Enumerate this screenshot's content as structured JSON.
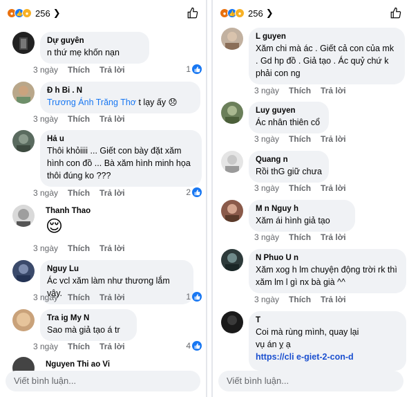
{
  "left": {
    "reaction_count": "256",
    "comments": [
      {
        "name": "Dự   guyên",
        "text": "  n thứ mẹ khốn nạn",
        "time": "3 ngày",
        "like": "Thích",
        "reply": "Trả lời",
        "likes": "1"
      },
      {
        "name": "Đ   h Bi  .   N",
        "mention": "Trương Ánh Trăng Thơ",
        "text": " t lạy ấy 😞",
        "time": "3 ngày",
        "like": "Thích",
        "reply": "Trả lời",
        "likes": ""
      },
      {
        "name": "Hả  u",
        "text": "Thôi khỏiiii ... Giết con bày đặt xăm hình con đồ ... Bà xăm hình minh họa thôi đúng ko ???",
        "time": "3 ngày",
        "like": "Thích",
        "reply": "Trả lời",
        "likes": "2"
      },
      {
        "name": "Thanh Thao",
        "text": "😌",
        "time": "3 ngày",
        "like": "Thích",
        "reply": "Trả lời",
        "likes": ""
      },
      {
        "name": "Nguy   Lu  ",
        "text": "Ác vcl xăm làm như thương lắm vậy.",
        "time": "3 ngày",
        "like": "Thích",
        "reply": "Trả lời",
        "likes": "1"
      },
      {
        "name": "Tra   ig   My N",
        "text": "Sao mà giả tạo á tr",
        "time": "3 ngày",
        "like": "Thích",
        "reply": "Trả lời",
        "likes": "4"
      },
      {
        "name": "Nguyen Thi   ao Vi",
        "text": "",
        "time": "",
        "like": "",
        "reply": "",
        "likes": ""
      }
    ],
    "input_placeholder": "Viết bình luận..."
  },
  "right": {
    "reaction_count": "256",
    "comments": [
      {
        "name": "L       guyen",
        "text": "Xăm chi mà ác . Giết cả con của mk . Gd hp đồ . Giả tạo . Ác quỷ chứ k phải con ng",
        "time": "3 ngày",
        "like": "Thích",
        "reply": "Trả lời"
      },
      {
        "name": "Luy    guyen",
        "text": "Ác nhân thiên cổ",
        "time": "3 ngày",
        "like": "Thích",
        "reply": "Trả lời"
      },
      {
        "name": "Quang   n",
        "text": "Rồi thG giữ chưa",
        "time": "3 ngày",
        "like": "Thích",
        "reply": "Trả lời"
      },
      {
        "name": "M   n Nguy  h",
        "text": "Xăm       ái hình giả tạo",
        "time": "3 ngày",
        "like": "Thích",
        "reply": "Trả lời"
      },
      {
        "name": "N  Phuo   U  n",
        "text": "Xăm xog h lm chuyện động trời rk thì xăm lm l gì nx bà già ^^",
        "time": "3 ngày",
        "like": "Thích",
        "reply": "Trả lời"
      },
      {
        "name": "T    ",
        "text1": "Coi mà  rùng mình,       quay lại",
        "text2": "vụ án   ỵ ạ",
        "link": "https://cli         e-giet-2-con-d",
        "time": "",
        "like": "",
        "reply": ""
      }
    ],
    "input_placeholder": "Viết bình luận..."
  }
}
